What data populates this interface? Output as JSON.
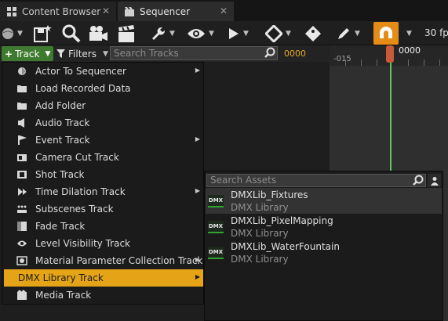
{
  "tabs": [
    {
      "label": "Content Browser",
      "close": "✕",
      "icon": "content-browser-icon"
    },
    {
      "label": "Sequencer",
      "close": "✕",
      "icon": "sequencer-icon"
    }
  ],
  "toolbar": {
    "fps": "30 fp",
    "accent": "#e58c17"
  },
  "filter_row": {
    "track_button": "Track",
    "filters_button": "Filters",
    "search_placeholder": "Search Tracks",
    "time_value": "0000"
  },
  "timeline": {
    "ruler_label": "-015",
    "playhead_label": "0000"
  },
  "track_menu": {
    "items": [
      {
        "label": "Actor To Sequencer",
        "icon": "actor-icon",
        "submenu": true
      },
      {
        "label": "Load Recorded Data",
        "icon": "folder-icon",
        "submenu": false
      },
      {
        "label": "Add Folder",
        "icon": "folder-icon",
        "submenu": false
      },
      {
        "label": "Audio Track",
        "icon": "speaker-icon",
        "submenu": false
      },
      {
        "label": "Event Track",
        "icon": "flag-icon",
        "submenu": true
      },
      {
        "label": "Camera Cut Track",
        "icon": "camera-cut-icon",
        "submenu": false
      },
      {
        "label": "Shot Track",
        "icon": "film-icon",
        "submenu": false
      },
      {
        "label": "Time Dilation Track",
        "icon": "play-forward-icon",
        "submenu": true
      },
      {
        "label": "Subscenes Track",
        "icon": "dots-grid-icon",
        "submenu": false
      },
      {
        "label": "Fade Track",
        "icon": "fade-icon",
        "submenu": false
      },
      {
        "label": "Level Visibility Track",
        "icon": "eye-icon",
        "submenu": false
      },
      {
        "label": "Material Parameter Collection Track",
        "icon": "material-icon",
        "submenu": true
      },
      {
        "label": "DMX Library Track",
        "icon": "",
        "submenu": true,
        "active": true
      },
      {
        "label": "Media Track",
        "icon": "media-icon",
        "submenu": false
      }
    ]
  },
  "dmx_submenu": {
    "search_placeholder": "Search Assets",
    "assets": [
      {
        "name": "DMXLib_Fixtures",
        "type": "DMX Library",
        "thumb": "DMX"
      },
      {
        "name": "DMXLib_PixelMapping",
        "type": "DMX Library",
        "thumb": "DMX"
      },
      {
        "name": "DMXLib_WaterFountain",
        "type": "DMX Library",
        "thumb": "DMX"
      }
    ]
  }
}
